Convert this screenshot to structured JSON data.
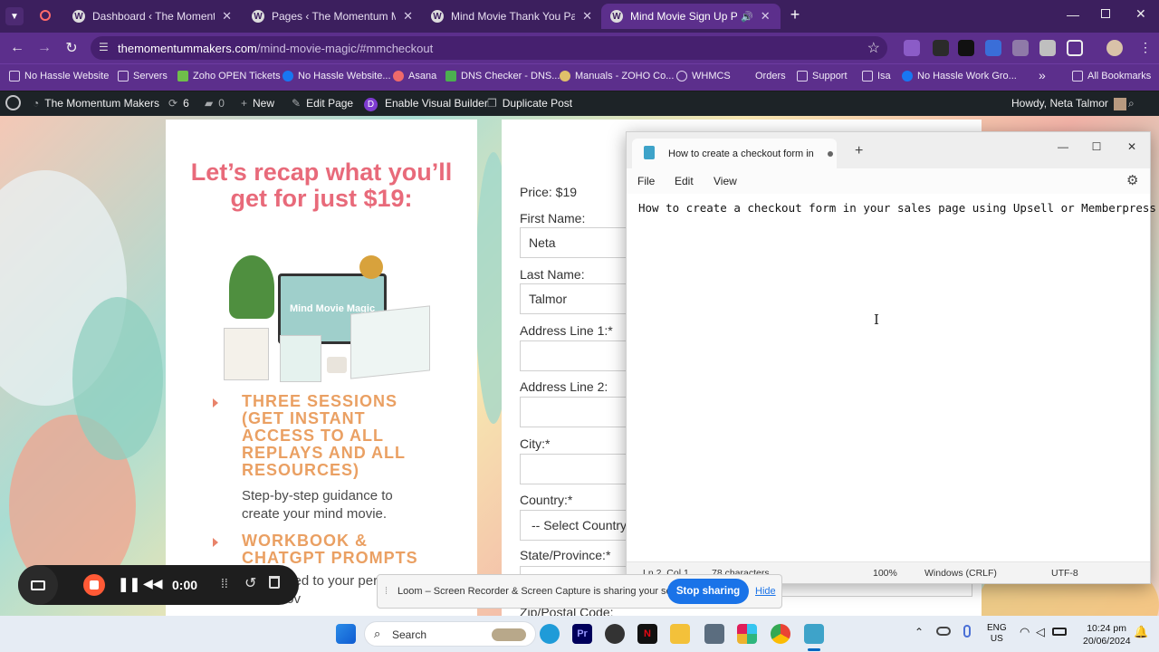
{
  "browser": {
    "tabs": [
      {
        "title": "Dashboard ‹ The Momentum M"
      },
      {
        "title": "Pages ‹ The Momentum Maker"
      },
      {
        "title": "Mind Movie Thank You Page | T"
      },
      {
        "title": "Mind Movie Sign Up Page |",
        "active": true
      }
    ],
    "new_tab": "+",
    "url_host": "themomentummakers.com",
    "url_path": "/mind-movie-magic/#mmcheckout",
    "bookmarks": [
      "No Hassle Website",
      "Servers",
      "Zoho OPEN Tickets",
      "No Hassle Website...",
      "Asana",
      "DNS Checker - DNS...",
      "Manuals - ZOHO Co...",
      "WHMCS",
      "Orders",
      "Support",
      "Isa",
      "No Hassle Work Gro..."
    ],
    "more_bookmarks": "»",
    "all_bookmarks": "All Bookmarks"
  },
  "wpbar": {
    "site": "The Momentum Makers",
    "updates": "6",
    "comments": "0",
    "new": "New",
    "edit_page": "Edit Page",
    "visual_builder": "Enable Visual Builder",
    "duplicate": "Duplicate Post",
    "howdy": "Howdy, Neta Talmor"
  },
  "page": {
    "headline": "Let’s recap what you’ll get for just $19:",
    "product_name": "Mind Movie Magic",
    "bullets": [
      {
        "title": "THREE SESSIONS (GET INSTANT ACCESS TO ALL REPLAYS AND ALL RESOURCES)",
        "body": "Step-by-step guidance to create your mind movie."
      },
      {
        "title": "WORKBOOK & CHATGPT PROMPTS",
        "body": "g you need to your perfect Mind Mov"
      }
    ],
    "form": {
      "price": "Price: $19",
      "first_name_label": "First Name:",
      "first_name_value": "Neta",
      "last_name_label": "Last Name:",
      "last_name_value": "Talmor",
      "address1_label": "Address Line 1:*",
      "address2_label": "Address Line 2:",
      "city_label": "City:*",
      "country_label": "Country:*",
      "country_value": "-- Select Country",
      "state_label": "State/Province:*",
      "zip_label": "Zip/Postal Code:"
    }
  },
  "notepad": {
    "tab_title": "How to create a checkout form in y",
    "menu": [
      "File",
      "Edit",
      "View"
    ],
    "content": "How to create a checkout form in your sales page using Upsell or Memberpress",
    "status_pos": "Ln 2, Col 1",
    "status_chars": "78 characters",
    "zoom": "100%",
    "line_ending": "Windows (CRLF)",
    "encoding": "UTF-8"
  },
  "loom": {
    "timer": "0:00",
    "sharing_text": "Loom – Screen Recorder & Screen Capture is sharing your screen.",
    "stop": "Stop sharing",
    "hide": "Hide"
  },
  "taskbar": {
    "search": "Search",
    "lang1": "ENG",
    "lang2": "US",
    "time": "10:24 pm",
    "date": "20/06/2024"
  },
  "colors": {
    "accent": "#5c2f8c",
    "headline": "#e86a7a",
    "bullet": "#eaa063",
    "loom_blue": "#1a73e8"
  }
}
